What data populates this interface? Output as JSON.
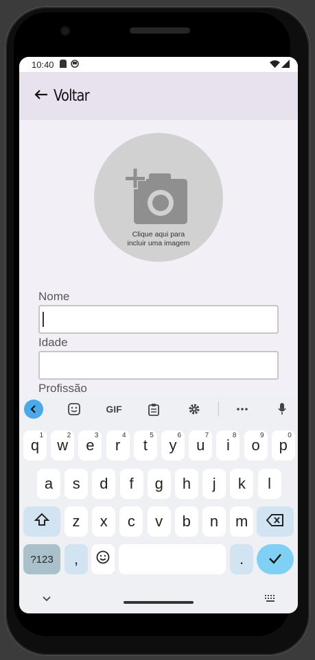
{
  "status": {
    "time": "10:40"
  },
  "appbar": {
    "back_label": "Voltar"
  },
  "photo": {
    "caption_line1": "Clique aqui para",
    "caption_line2": "incluir uma imagem"
  },
  "form": {
    "name_label": "Nome",
    "name_value": "",
    "age_label": "Idade",
    "age_value": "",
    "profession_label": "Profissão"
  },
  "keyboard": {
    "toolbar": [
      "back-chevron-icon",
      "sticker-icon",
      "gif-icon",
      "clipboard-icon",
      "settings-icon",
      "more-icon",
      "mic-icon"
    ],
    "gif_label": "GIF",
    "row1": [
      {
        "k": "q",
        "h": "1"
      },
      {
        "k": "w",
        "h": "2"
      },
      {
        "k": "e",
        "h": "3"
      },
      {
        "k": "r",
        "h": "4"
      },
      {
        "k": "t",
        "h": "5"
      },
      {
        "k": "y",
        "h": "6"
      },
      {
        "k": "u",
        "h": "7"
      },
      {
        "k": "i",
        "h": "8"
      },
      {
        "k": "o",
        "h": "9"
      },
      {
        "k": "p",
        "h": "0"
      }
    ],
    "row2": [
      "a",
      "s",
      "d",
      "f",
      "g",
      "h",
      "j",
      "k",
      "l"
    ],
    "row3": [
      "z",
      "x",
      "c",
      "v",
      "b",
      "n",
      "m"
    ],
    "sym_label": "?123",
    "comma_label": ",",
    "period_label": ".",
    "accent_color": "#7fd0f4"
  }
}
